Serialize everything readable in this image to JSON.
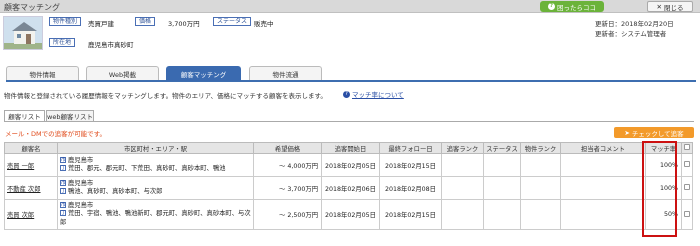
{
  "window": {
    "title": "顧客マッチング",
    "help_label": "困ったらココ",
    "close_label": "閉じる"
  },
  "property": {
    "type_tag": "物件種別",
    "type_value": "売買戸建",
    "price_tag": "価格",
    "price_value": "3,700万円",
    "status_tag": "ステータス",
    "status_value": "販売中",
    "location_tag": "所在地",
    "location_value": "鹿児島市真砂町"
  },
  "updates": {
    "updated_on": "更新日：2018年02月20日",
    "updated_by": "更新者：システム管理者"
  },
  "tabs": [
    {
      "label": "物件情報"
    },
    {
      "label": "Web掲載"
    },
    {
      "label": "顧客マッチング"
    },
    {
      "label": "物件流通"
    }
  ],
  "description": "物件情報と登録されている履歴情報をマッチングします。物件のエリア、価格にマッチする顧客を表示します。",
  "match_link": "マッチ率について",
  "subtabs": [
    {
      "label": "顧客リスト"
    },
    {
      "label": "web顧客リスト"
    }
  ],
  "notice": "メール・DMでの追客が可能です。",
  "check_button": "チェックして追客",
  "table": {
    "headers": [
      "顧客名",
      "市区町村・エリア・駅",
      "希望価格",
      "追客開始日",
      "最終フォロー日",
      "追客ランク",
      "ステータス",
      "物件ランク",
      "担当者コメント",
      "マッチ率",
      ""
    ],
    "rows": [
      {
        "name": "売買 一郎",
        "area1": "鹿児島市",
        "area2": "荒田、郡元、郡元町、下荒田、真砂町、真砂本町、鴨池",
        "price": "〜 4,000万円",
        "start": "2018年02月05日",
        "last": "2018年02月15日",
        "rank": "",
        "status": "",
        "prop_rank": "",
        "comment": "",
        "match": "100%"
      },
      {
        "name": "不動産 次郎",
        "area1": "鹿児島市",
        "area2": "鴨池、真砂町、真砂本町、与次郎",
        "price": "〜 3,700万円",
        "start": "2018年02月06日",
        "last": "2018年02月08日",
        "rank": "",
        "status": "",
        "prop_rank": "",
        "comment": "",
        "match": "100%"
      },
      {
        "name": "売買 次郎",
        "area1": "鹿児島市",
        "area2": "荒田、宇宿、鴨池、鴨池新町、郡元町、真砂町、真砂本町、与次郎",
        "price": "〜 2,500万円",
        "start": "2018年02月05日",
        "last": "2018年02月15日",
        "rank": "",
        "status": "",
        "prop_rank": "",
        "comment": "",
        "match": "50%"
      }
    ]
  }
}
